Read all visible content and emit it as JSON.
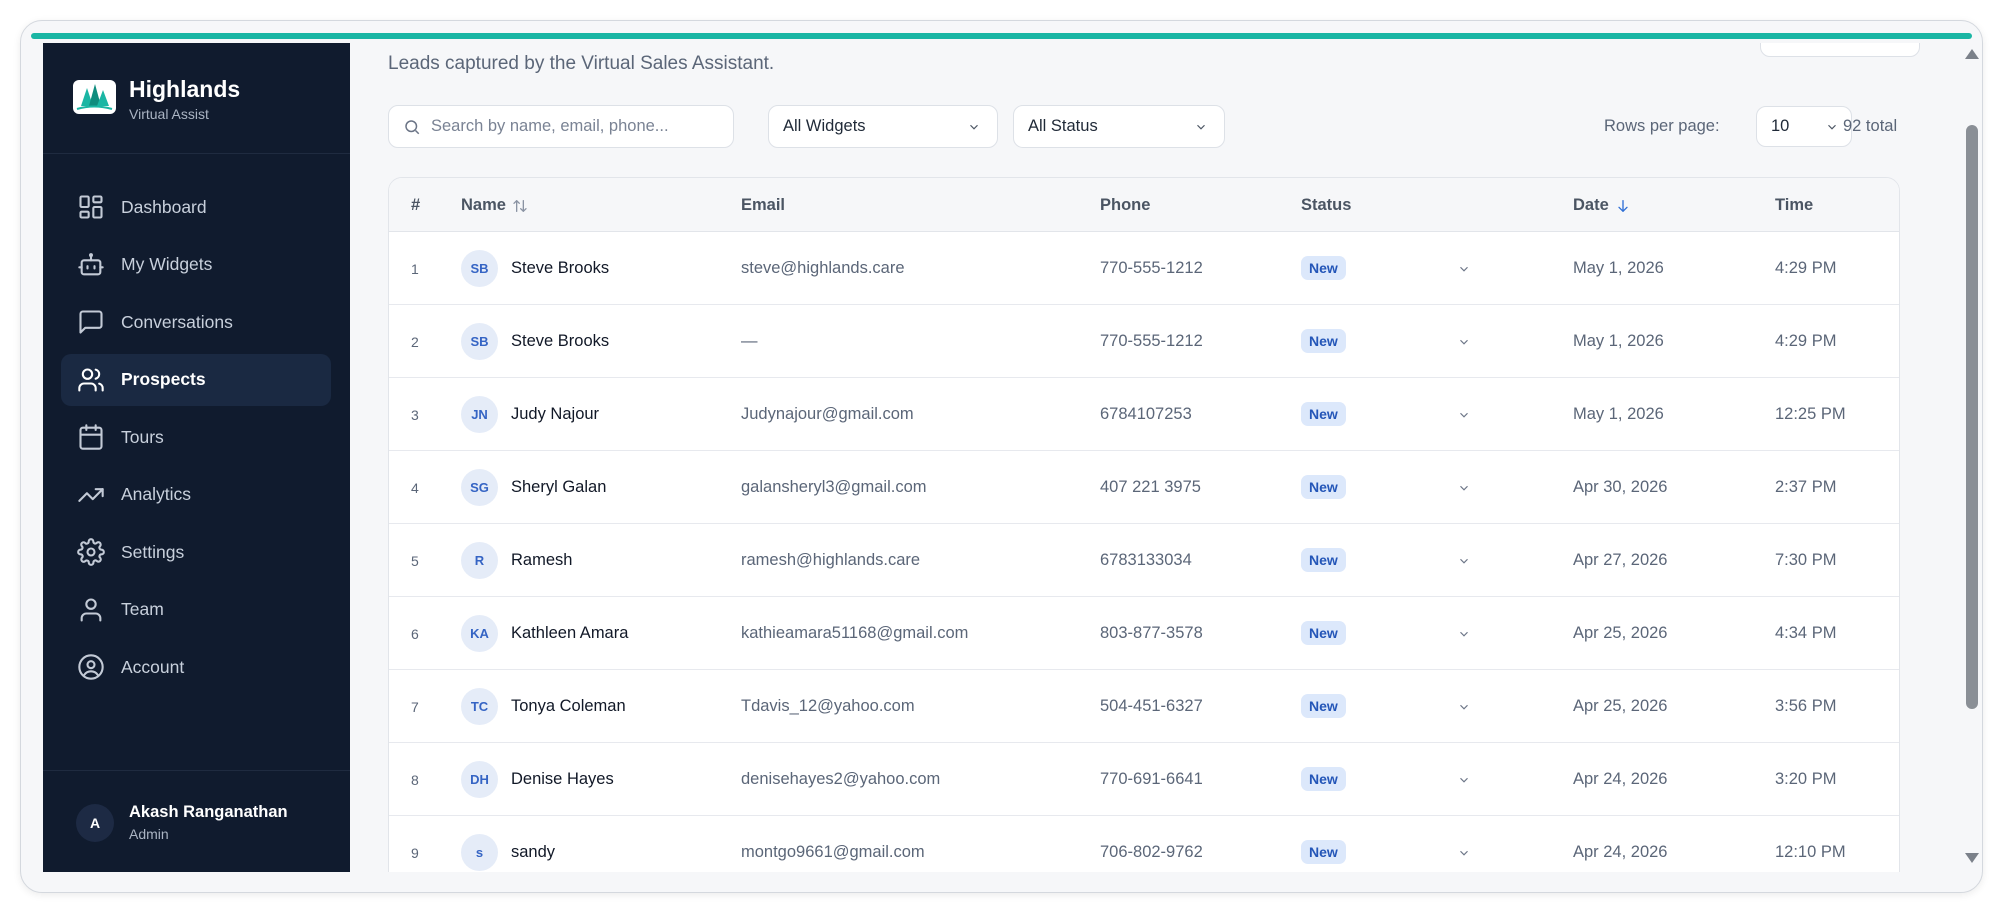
{
  "brand": {
    "name": "Highlands",
    "subtitle": "Virtual Assist"
  },
  "sidebar": {
    "items": [
      {
        "label": "Dashboard",
        "icon": "dashboard-icon"
      },
      {
        "label": "My Widgets",
        "icon": "bot-icon"
      },
      {
        "label": "Conversations",
        "icon": "chat-icon"
      },
      {
        "label": "Prospects",
        "icon": "users-icon",
        "active": true
      },
      {
        "label": "Tours",
        "icon": "calendar-icon"
      },
      {
        "label": "Analytics",
        "icon": "trending-up-icon"
      },
      {
        "label": "Settings",
        "icon": "gear-icon"
      },
      {
        "label": "Team",
        "icon": "user-icon"
      },
      {
        "label": "Account",
        "icon": "user-circle-icon"
      }
    ]
  },
  "user": {
    "initial": "A",
    "name": "Akash Ranganathan",
    "role": "Admin"
  },
  "page": {
    "subtitle": "Leads captured by the Virtual Sales Assistant."
  },
  "filters": {
    "search_placeholder": "Search by name, email, phone...",
    "widget_select": "All Widgets",
    "status_select": "All Status",
    "rows_per_page_label": "Rows per page:",
    "rows_per_page_value": "10",
    "total": "92 total"
  },
  "table": {
    "headers": {
      "index": "#",
      "name": "Name",
      "email": "Email",
      "phone": "Phone",
      "status": "Status",
      "date": "Date",
      "time": "Time"
    },
    "rows": [
      {
        "index": "1",
        "initials": "SB",
        "name": "Steve Brooks",
        "email": "steve@highlands.care",
        "phone": "770-555-1212",
        "status": "New",
        "date": "May 1, 2026",
        "time": "4:29 PM"
      },
      {
        "index": "2",
        "initials": "SB",
        "name": "Steve Brooks",
        "email": "—",
        "phone": "770-555-1212",
        "status": "New",
        "date": "May 1, 2026",
        "time": "4:29 PM"
      },
      {
        "index": "3",
        "initials": "JN",
        "name": "Judy Najour",
        "email": "Judynajour@gmail.com",
        "phone": "6784107253",
        "status": "New",
        "date": "May 1, 2026",
        "time": "12:25 PM"
      },
      {
        "index": "4",
        "initials": "SG",
        "name": "Sheryl Galan",
        "email": "galansheryl3@gmail.com",
        "phone": "407 221 3975",
        "status": "New",
        "date": "Apr 30, 2026",
        "time": "2:37 PM"
      },
      {
        "index": "5",
        "initials": "R",
        "name": "Ramesh",
        "email": "ramesh@highlands.care",
        "phone": "6783133034",
        "status": "New",
        "date": "Apr 27, 2026",
        "time": "7:30 PM"
      },
      {
        "index": "6",
        "initials": "KA",
        "name": "Kathleen Amara",
        "email": "kathieamara51168@gmail.com",
        "phone": "803-877-3578",
        "status": "New",
        "date": "Apr 25, 2026",
        "time": "4:34 PM"
      },
      {
        "index": "7",
        "initials": "TC",
        "name": "Tonya Coleman",
        "email": "Tdavis_12@yahoo.com",
        "phone": "504-451-6327",
        "status": "New",
        "date": "Apr 25, 2026",
        "time": "3:56 PM"
      },
      {
        "index": "8",
        "initials": "DH",
        "name": "Denise Hayes",
        "email": "denisehayes2@yahoo.com",
        "phone": "770-691-6641",
        "status": "New",
        "date": "Apr 24, 2026",
        "time": "3:20 PM"
      },
      {
        "index": "9",
        "initials": "s",
        "name": "sandy",
        "email": "montgo9661@gmail.com",
        "phone": "706-802-9762",
        "status": "New",
        "date": "Apr 24, 2026",
        "time": "12:10 PM"
      }
    ]
  }
}
